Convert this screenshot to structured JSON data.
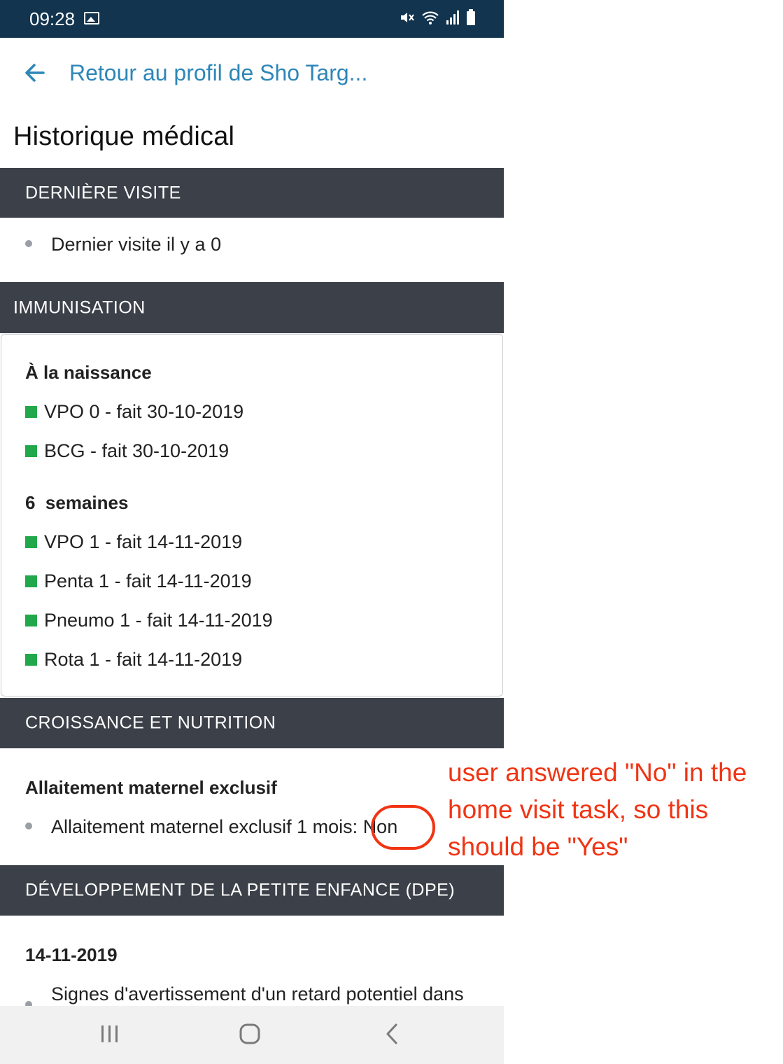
{
  "status_bar": {
    "time": "09:28",
    "icons": [
      "image-icon",
      "mute-icon",
      "wifi-icon",
      "signal-icon",
      "battery-icon"
    ]
  },
  "back_link": {
    "label": "Retour au profil de Sho Targ..."
  },
  "page_title": "Historique médical",
  "sections": {
    "last_visit": {
      "header": "DERNIÈRE VISITE",
      "items": [
        "Dernier visite il y a 0"
      ]
    },
    "immunisation": {
      "header": "IMMUNISATION",
      "groups": [
        {
          "title": "À la naissance",
          "items": [
            "VPO 0 - fait 30-10-2019",
            "BCG - fait 30-10-2019"
          ]
        },
        {
          "title": "6  semaines",
          "items": [
            "VPO 1 - fait 14-11-2019",
            "Penta 1 - fait 14-11-2019",
            "Pneumo 1 - fait 14-11-2019",
            "Rota 1 - fait 14-11-2019"
          ]
        }
      ],
      "status_color": "#22a84a"
    },
    "growth": {
      "header": "CROISSANCE ET NUTRITION",
      "subtitle": "Allaitement maternel exclusif",
      "item_label": "Allaitement maternel exclusif 1 mois:",
      "item_value": "Non"
    },
    "dpe": {
      "header": "DÉVELOPPEMENT DE LA PETITE ENFANCE (DPE)",
      "date": "14-11-2019",
      "item": "Signes d'avertissement d'un retard potentiel dans"
    }
  },
  "annotation": {
    "lines": [
      "user answered \"No\" in the",
      "home visit task, so this",
      "should be \"Yes\""
    ],
    "color": "#f03414"
  },
  "nav_bar": {
    "buttons": [
      "recent-apps-icon",
      "home-icon",
      "back-icon"
    ]
  }
}
